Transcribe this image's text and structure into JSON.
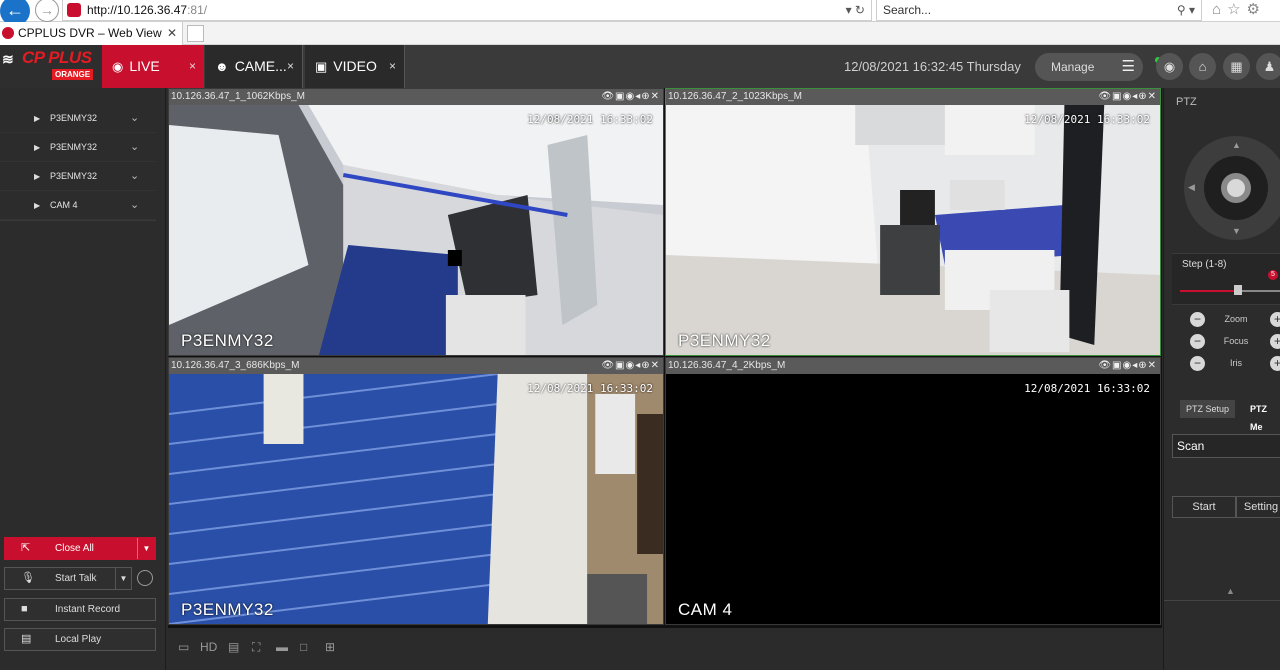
{
  "browser": {
    "url_host": "http://10.126.36.47",
    "url_port": ":81/",
    "url_controls": "▾ ↻",
    "search_placeholder": "Search...",
    "search_controls": "⚲ ▾",
    "tab_title": "CPPLUS DVR – Web View",
    "tab_close": "✕"
  },
  "header": {
    "logo_text": "CP PLUS",
    "logo_sub": "ORANGE",
    "tabs": [
      {
        "label": "LIVE",
        "close": "×"
      },
      {
        "label": "CAME...",
        "close": "×"
      },
      {
        "label": "VIDEO",
        "close": "×"
      }
    ],
    "datetime": "12/08/2021 16:32:45 Thursday",
    "manage_label": "Manage"
  },
  "sidebar": {
    "cameras": [
      {
        "label": "P3ENMY32"
      },
      {
        "label": "P3ENMY32"
      },
      {
        "label": "P3ENMY32"
      },
      {
        "label": "CAM 4"
      }
    ],
    "close_all": "Close All",
    "start_talk": "Start Talk",
    "instant_record": "Instant Record",
    "local_play": "Local Play"
  },
  "panes": [
    {
      "header": "10.126.36.47_1_1062Kbps_M",
      "timestamp": "12/08/2021 16:33:02",
      "name": "P3ENMY32"
    },
    {
      "header": "10.126.36.47_2_1023Kbps_M",
      "timestamp": "12/08/2021 16:33:02",
      "name": "P3ENMY32"
    },
    {
      "header": "10.126.36.47_3_686Kbps_M",
      "timestamp": "12/08/2021 16:33:02",
      "name": "P3ENMY32"
    },
    {
      "header": "10.126.36.47_4_2Kbps_M",
      "timestamp": "12/08/2021 16:33:02",
      "name": "CAM 4"
    }
  ],
  "pane_icons": "👁▣◉◂⊕✕",
  "video_toolbar": {
    "hd_label": "HD"
  },
  "ptz": {
    "title": "PTZ",
    "step_label": "Step (1-8)",
    "step_value": "5",
    "step_fraction": 0.62,
    "zoom": "Zoom",
    "focus": "Focus",
    "iris": "Iris",
    "tab_setup": "PTZ Setup",
    "tab_menu": "PTZ Me",
    "scan_value": "Scan",
    "start": "Start",
    "setting": "Setting"
  },
  "colors": {
    "accent": "#c8102e",
    "active_pane_border": "#3a8f3a"
  }
}
